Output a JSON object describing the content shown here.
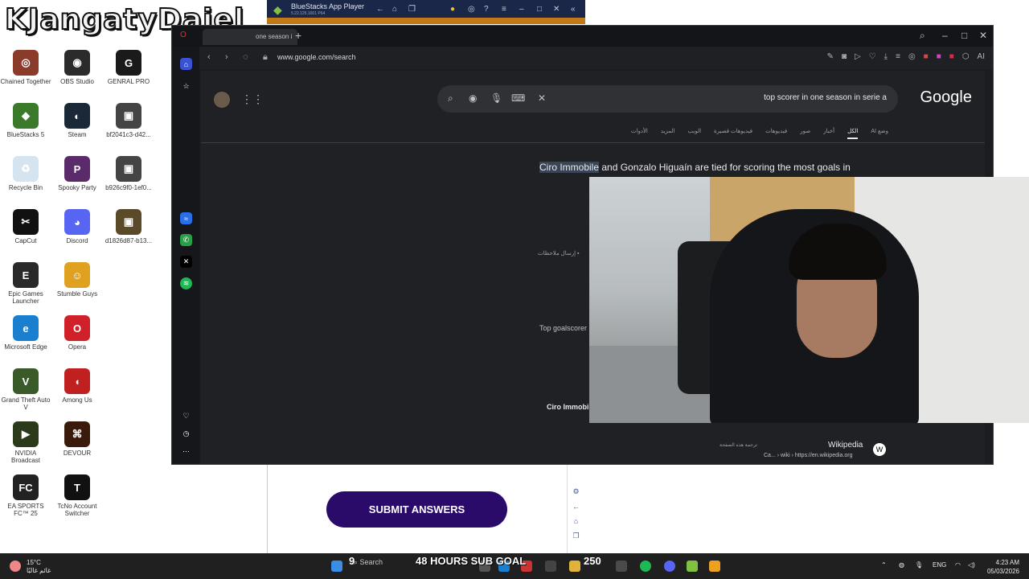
{
  "stream": {
    "title": "KJangatyDajel",
    "goal_text": "48 HOURS SUB GOAL",
    "count_left": "9",
    "count_right": "250"
  },
  "desktop": {
    "icons": [
      {
        "label": "Chained Together",
        "color": "#8a3b2a",
        "glyph": "◎"
      },
      {
        "label": "OBS Studio",
        "color": "#2b2b2b",
        "glyph": "◉"
      },
      {
        "label": "GENRAL PRO",
        "color": "#1a1a1a",
        "glyph": "G"
      },
      {
        "label": "BlueStacks 5",
        "color": "#3a7a2a",
        "glyph": "◆"
      },
      {
        "label": "Steam",
        "color": "#1b2838",
        "glyph": "◐"
      },
      {
        "label": "bf2041c3-d42...",
        "color": "#444",
        "glyph": "▣"
      },
      {
        "label": "Recycle Bin",
        "color": "#d6e4ef",
        "glyph": "♻"
      },
      {
        "label": "Spooky Party",
        "color": "#5a2a6a",
        "glyph": "P"
      },
      {
        "label": "b926c9f0-1ef0...",
        "color": "#444",
        "glyph": "▣"
      },
      {
        "label": "CapCut",
        "color": "#111",
        "glyph": "✂"
      },
      {
        "label": "Discord",
        "color": "#5865f2",
        "glyph": "◕"
      },
      {
        "label": "d1826d87-b13...",
        "color": "#5a4a2a",
        "glyph": "▣"
      },
      {
        "label": "Epic Games Launcher",
        "color": "#2a2a2a",
        "glyph": "E"
      },
      {
        "label": "Stumble Guys",
        "color": "#e0a020",
        "glyph": "☺"
      },
      {
        "label": "Microsoft Edge",
        "color": "#1b7fd0",
        "glyph": "e"
      },
      {
        "label": "Opera",
        "color": "#d0202a",
        "glyph": "O"
      },
      {
        "label": "Grand Theft Auto V",
        "color": "#3a5a2a",
        "glyph": "V"
      },
      {
        "label": "Among Us",
        "color": "#c02020",
        "glyph": "◖"
      },
      {
        "label": "NVIDIA Broadcast",
        "color": "#2a3a1a",
        "glyph": "▶"
      },
      {
        "label": "DEVOUR",
        "color": "#3a1a0a",
        "glyph": "⌘"
      },
      {
        "label": "EA SPORTS FC™ 25",
        "color": "#222",
        "glyph": "FC"
      },
      {
        "label": "TcNo Account Switcher",
        "color": "#111",
        "glyph": "T"
      }
    ]
  },
  "bluestacks": {
    "title": "BlueStacks App Player",
    "version": "5.22.125.1001 P64",
    "submit_label": "SUBMIT ANSWERS"
  },
  "browser": {
    "tab_label": "one season i",
    "url": "www.google.com/search",
    "ai_label": "AI"
  },
  "google": {
    "query": "top scorer in one season in serie a",
    "logo": "Google",
    "tabs": [
      "وضع AI",
      "الكل",
      "أخبار",
      "صور",
      "فيديوهات",
      "فيديوهات قصيرة",
      "الويب",
      "المزيد",
      "الأدوات"
    ],
    "active_tab": "الكل",
    "snippet_hl": "Ciro Immobile",
    "snippet_rest": " and Gonzalo Higuaín are tied for scoring the most goals in",
    "feedback": "إرسال ملاحظات",
    "top_goalscorer": "Top goalscorer",
    "ciro": "Ciro Immobi",
    "wiki_title": "Wikipedia",
    "wiki_url": "Ca... › wiki › https://en.wikipedia.org",
    "translate": "ترجمة هذه الصفحة"
  },
  "taskbar": {
    "temp": "15°C",
    "weather_desc": "غائم غالبًا",
    "search_placeholder": "Search",
    "lang": "ENG",
    "time": "4:23 AM",
    "date": "05/03/2026"
  }
}
